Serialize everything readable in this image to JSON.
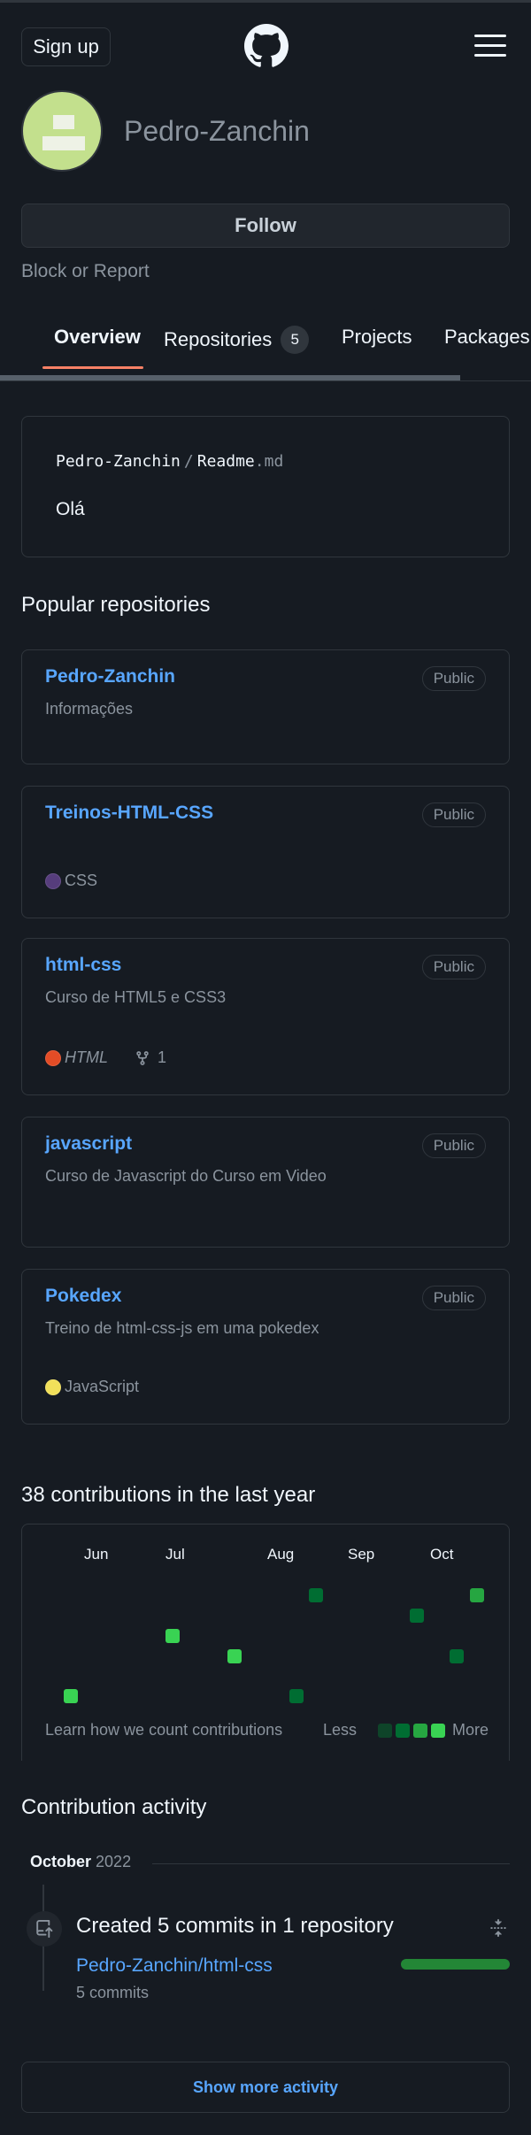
{
  "header": {
    "signup_label": "Sign up",
    "logo_icon": "github-mark-icon",
    "menu_icon": "hamburger-menu-icon"
  },
  "profile": {
    "username": "Pedro-Zanchin",
    "follow_label": "Follow",
    "block_report": "Block or Report"
  },
  "tabs": [
    {
      "label": "Overview",
      "active": true
    },
    {
      "label": "Repositories",
      "count": "5"
    },
    {
      "label": "Projects"
    },
    {
      "label": "Packages"
    }
  ],
  "readme": {
    "owner": "Pedro-Zanchin",
    "separator": "/",
    "file": "Readme",
    "ext": ".md",
    "body": "Olá"
  },
  "popular": {
    "title": "Popular repositories",
    "repos": [
      {
        "name": "Pedro-Zanchin",
        "visibility": "Public",
        "description": "Informações"
      },
      {
        "name": "Treinos-HTML-CSS",
        "visibility": "Public",
        "language": "CSS",
        "language_color": "#563d7c"
      },
      {
        "name": "html-css",
        "visibility": "Public",
        "description": "Curso de HTML5 e CSS3",
        "language": "HTML",
        "language_color": "#e34c26",
        "forks": "1"
      },
      {
        "name": "javascript",
        "visibility": "Public",
        "description": "Curso de Javascript do Curso em Video"
      },
      {
        "name": "Pokedex",
        "visibility": "Public",
        "description": "Treino de html-css-js em uma pokedex",
        "language": "JavaScript",
        "language_color": "#f1e05a"
      }
    ]
  },
  "contributions": {
    "title": "38 contributions in the last year",
    "months": [
      "Jun",
      "Jul",
      "Aug",
      "Sep",
      "Oct"
    ],
    "learn_link": "Learn how we count contributions",
    "legend_less": "Less",
    "legend_more": "More",
    "legend_colors": [
      "#0e4429",
      "#006d32",
      "#26a641",
      "#39d353"
    ]
  },
  "activity": {
    "title": "Contribution activity",
    "month": "October",
    "year": "2022",
    "headline": "Created 5 commits in 1 repository",
    "repo": "Pedro-Zanchin/html-css",
    "commits": "5 commits",
    "show_more": "Show more activity"
  },
  "colors": {
    "background": "#161b22",
    "link": "#58a6ff",
    "tab_accent": "#f78166",
    "border": "#30363d"
  }
}
